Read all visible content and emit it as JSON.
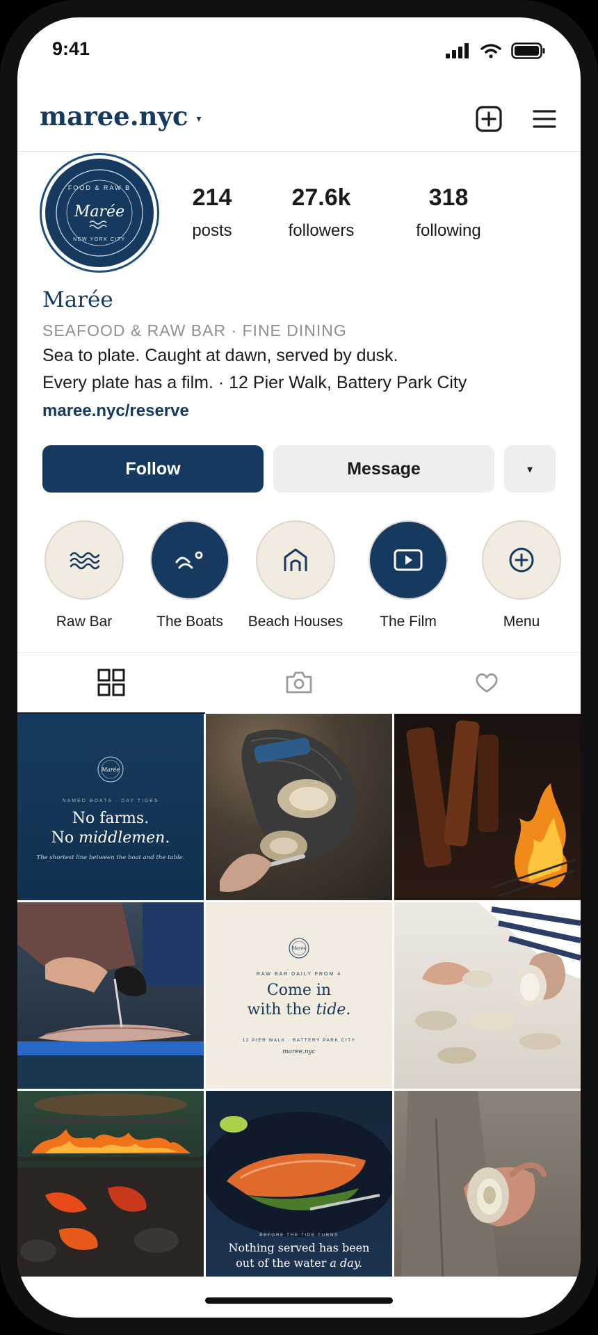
{
  "status_bar": {
    "time": "9:41"
  },
  "header": {
    "username": "maree.nyc",
    "caret": "▾"
  },
  "profile": {
    "avatar": {
      "ring_text": "FOOD & RAW B",
      "brand": "Marée",
      "city": "NEW YORK CITY"
    },
    "stats": [
      {
        "value": "214",
        "label": "posts"
      },
      {
        "value": "27.6k",
        "label": "followers"
      },
      {
        "value": "318",
        "label": "following"
      }
    ],
    "display_name": "Marée",
    "category": "SEAFOOD & RAW BAR · FINE DINING",
    "bio_lines": [
      "Sea to plate. Caught at dawn, served by dusk.",
      "Every plate has a film. · 12 Pier Walk, Battery Park City"
    ],
    "link": "maree.nyc/reserve"
  },
  "actions": {
    "follow": "Follow",
    "message": "Message",
    "more": "▾"
  },
  "highlights": [
    {
      "label": "Raw Bar",
      "icon": "waves-icon",
      "style": "light"
    },
    {
      "label": "The Boats",
      "icon": "boat-icon",
      "style": "dark"
    },
    {
      "label": "Beach Houses",
      "icon": "house-icon",
      "style": "light"
    },
    {
      "label": "The Film",
      "icon": "play-icon",
      "style": "dark"
    },
    {
      "label": "Menu",
      "icon": "plus-circle-icon",
      "style": "light"
    }
  ],
  "tabs": [
    {
      "icon": "grid-icon",
      "active": true
    },
    {
      "icon": "tagged-camera-icon",
      "active": false
    },
    {
      "icon": "heart-icon",
      "active": false
    }
  ],
  "posts": {
    "post1": {
      "logo": "Marée",
      "kicker": "NAMED BOATS · DAY TIDES",
      "line1": "No farms.",
      "line2_a": "No ",
      "line2_b": "middlemen.",
      "caption": "The shortest line between the boat and the table."
    },
    "post2": {
      "photo": "oyster shucking with chain-mail glove"
    },
    "post3": {
      "photo": "wood fire flames"
    },
    "post4": {
      "photo": "filleting fish at the market"
    },
    "post5": {
      "logo": "Marée",
      "kicker": "RAW BAR DAILY FROM 4",
      "line1": "Come in",
      "line2_a": "with the ",
      "line2_b": "tide.",
      "address": "12 PIER WALK · BATTERY PARK CITY",
      "handle": "maree.nyc"
    },
    "post6": {
      "photo": "shucked oysters on ice"
    },
    "post7": {
      "photo": "grill over hot coals"
    },
    "post8": {
      "kicker": "BEFORE THE TIDE TURNS",
      "line1": "Nothing served has been",
      "line2_a": "out of the water ",
      "line2_b": "a day."
    },
    "post9": {
      "photo": "hand holding an oyster"
    }
  },
  "colors": {
    "navy": "#163a5f",
    "cream": "#f1ebe0",
    "grey_button": "#eeeeee"
  }
}
